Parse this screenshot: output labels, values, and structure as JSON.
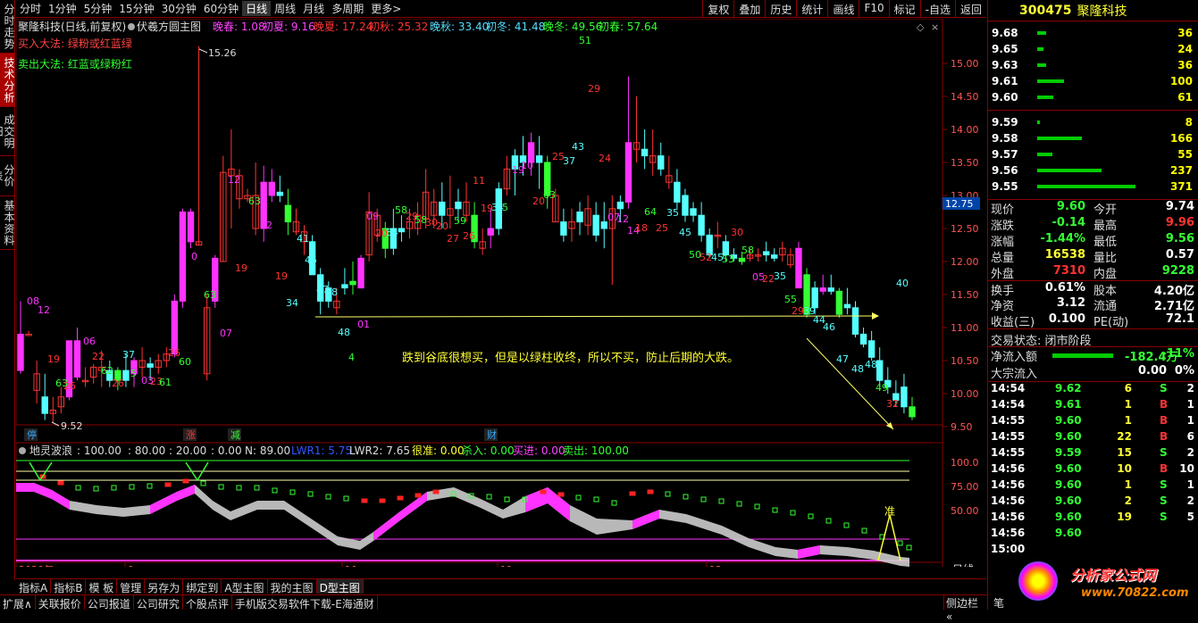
{
  "left_tabs": [
    "分时走势",
    "技术分析",
    "成交明细",
    "分价表",
    "基本资料"
  ],
  "top_tabs": [
    "分时",
    "1分钟",
    "5分钟",
    "15分钟",
    "30分钟",
    "60分钟",
    "日线",
    "周线",
    "月线",
    "多周期",
    "更多>"
  ],
  "top_tabs_active": 6,
  "top_right": [
    "复权",
    "叠加",
    "历史",
    "统计",
    "画线",
    "F10",
    "标记",
    "-自选",
    "返回"
  ],
  "chart": {
    "title": "聚隆科技(日线,前复权)",
    "indicator_name": "伏羲方圆主图",
    "season_labels": [
      {
        "text": "晚春: 1.08",
        "color": "#ff44ff"
      },
      {
        "text": "初夏: 9.16",
        "color": "#ff44ff"
      },
      {
        "text": "晚夏: 17.24",
        "color": "#ff3333"
      },
      {
        "text": "初秋: 25.32",
        "color": "#ff3333"
      },
      {
        "text": "晚秋: 33.40",
        "color": "#55ddff"
      },
      {
        "text": "初冬: 41.48",
        "color": "#55ddff"
      },
      {
        "text": "晚冬: 49.56",
        "color": "#33ff33"
      },
      {
        "text": "初春: 57.64",
        "color": "#33ff33"
      }
    ],
    "buy_method": "买入大法: 绿粉或红蓝绿",
    "sell_method": "卖出大法: 红蓝或绿粉红",
    "annotation": "跌到谷底很想买，但是以绿柱收终，所以不买，防止后期的大跌。",
    "high_label": "15.26",
    "low_label": "9.52",
    "price_axis": [
      "15.00",
      "14.50",
      "14.00",
      "13.50",
      "13.00",
      "12.50",
      "12.00",
      "11.50",
      "11.00",
      "10.50",
      "10.00",
      "9.50"
    ],
    "current_price_tag": "12.75",
    "markers": [
      "停",
      "涨",
      "减",
      "财"
    ]
  },
  "sub": {
    "name": "地灵波浪",
    "params": [
      {
        "text": ": 100.00",
        "color": "#ddd"
      },
      {
        "text": ": 80.00",
        "color": "#ddd"
      },
      {
        "text": ": 20.00",
        "color": "#ddd"
      },
      {
        "text": ": 0.00",
        "color": "#ddd"
      },
      {
        "text": "N: 89.00",
        "color": "#ddd"
      },
      {
        "text": "LWR1: 5.75",
        "color": "#3355ff"
      },
      {
        "text": "LWR2: 7.65",
        "color": "#ddd"
      },
      {
        "text": "很准: 0.00",
        "color": "#ffff33"
      },
      {
        "text": "杀入: 0.00",
        "color": "#33ff33"
      },
      {
        "text": "买进: 0.00",
        "color": "#ff44ff"
      },
      {
        "text": "卖出: 100.00",
        "color": "#33ff33"
      }
    ],
    "axis": [
      "100.0",
      "75.00",
      "50.00"
    ],
    "zhun": "准"
  },
  "date_axis": [
    "2020年",
    "9",
    "10",
    "11",
    "12"
  ],
  "period_label": "日线",
  "bottom_tabs": [
    "指标A",
    "指标B",
    "模 板",
    "管理",
    "另存为",
    "绑定到",
    "A型主图",
    "我的主图",
    "D型主图"
  ],
  "bottom_tabs_active": 8,
  "bottom_links": [
    "扩展∧",
    "关联报价",
    "公司报道",
    "公司研究",
    "个股点评",
    "手机版交易软件下载-E海通财"
  ],
  "side_tabs": [
    "侧边栏 «",
    "笔"
  ],
  "stock": {
    "code": "300475",
    "name": "聚隆科技"
  },
  "asks": [
    {
      "price": "9.68",
      "vol": "36",
      "bar": 10
    },
    {
      "price": "9.65",
      "vol": "24",
      "bar": 7
    },
    {
      "price": "9.63",
      "vol": "36",
      "bar": 10
    },
    {
      "price": "9.61",
      "vol": "100",
      "bar": 30
    },
    {
      "price": "9.60",
      "vol": "61",
      "bar": 18
    }
  ],
  "bids": [
    {
      "price": "9.59",
      "vol": "8",
      "bar": 3
    },
    {
      "price": "9.58",
      "vol": "166",
      "bar": 50
    },
    {
      "price": "9.57",
      "vol": "55",
      "bar": 17
    },
    {
      "price": "9.56",
      "vol": "237",
      "bar": 72
    },
    {
      "price": "9.55",
      "vol": "371",
      "bar": 110
    }
  ],
  "quote": [
    {
      "l": "现价",
      "v": "9.60",
      "vc": "#33ff33",
      "l2": "今开",
      "v2": "9.74",
      "v2c": "#fff"
    },
    {
      "l": "涨跌",
      "v": "-0.14",
      "vc": "#33ff33",
      "l2": "最高",
      "v2": "9.96",
      "v2c": "#ff3333"
    },
    {
      "l": "涨幅",
      "v": "-1.44%",
      "vc": "#33ff33",
      "l2": "最低",
      "v2": "9.56",
      "v2c": "#33ff33"
    },
    {
      "l": "总量",
      "v": "16538",
      "vc": "#ffff33",
      "l2": "量比",
      "v2": "0.57",
      "v2c": "#fff"
    },
    {
      "l": "外盘",
      "v": "7310",
      "vc": "#ff3333",
      "l2": "内盘",
      "v2": "9228",
      "v2c": "#33ff33"
    },
    {
      "l": "换手",
      "v": "0.61%",
      "vc": "#fff",
      "l2": "股本",
      "v2": "4.20亿",
      "v2c": "#fff"
    },
    {
      "l": "净资",
      "v": "3.12",
      "vc": "#fff",
      "l2": "流通",
      "v2": "2.71亿",
      "v2c": "#fff"
    },
    {
      "l": "收益(三)",
      "v": "0.100",
      "vc": "#fff",
      "l2": "PE(动)",
      "v2": "72.1",
      "v2c": "#fff"
    }
  ],
  "trade_status": "交易状态: 闭市阶段",
  "net_inflow": {
    "label": "净流入额",
    "value": "-182.4万",
    "pct": "-11%"
  },
  "block_inflow": {
    "label": "大宗流入",
    "value": "0.00",
    "pct": "0%"
  },
  "ticks": [
    {
      "t": "14:54",
      "p": "9.62",
      "v": "6",
      "s": "S",
      "n": "2"
    },
    {
      "t": "14:54",
      "p": "9.61",
      "v": "1",
      "s": "B",
      "n": "1"
    },
    {
      "t": "14:55",
      "p": "9.60",
      "v": "1",
      "s": "B",
      "n": "1"
    },
    {
      "t": "14:55",
      "p": "9.60",
      "v": "22",
      "s": "B",
      "n": "6"
    },
    {
      "t": "14:55",
      "p": "9.59",
      "v": "15",
      "s": "S",
      "n": "2"
    },
    {
      "t": "14:56",
      "p": "9.60",
      "v": "10",
      "s": "B",
      "n": "10"
    },
    {
      "t": "14:56",
      "p": "9.60",
      "v": "1",
      "s": "S",
      "n": "1"
    },
    {
      "t": "14:56",
      "p": "9.60",
      "v": "2",
      "s": "S",
      "n": "2"
    },
    {
      "t": "14:56",
      "p": "9.60",
      "v": "19",
      "s": "S",
      "n": "5"
    },
    {
      "t": "14:56",
      "p": "9.60",
      "v": "",
      "s": "",
      "n": ""
    },
    {
      "t": "15:00",
      "p": "",
      "v": "",
      "s": "",
      "n": ""
    }
  ],
  "watermark": {
    "title": "分析家公式网",
    "url": "www.70822.com"
  },
  "colors": {
    "up": "#ff3333",
    "down": "#33ff33",
    "frame": "#880000",
    "magenta": "#ff33ff",
    "cyan": "#55ffff"
  }
}
